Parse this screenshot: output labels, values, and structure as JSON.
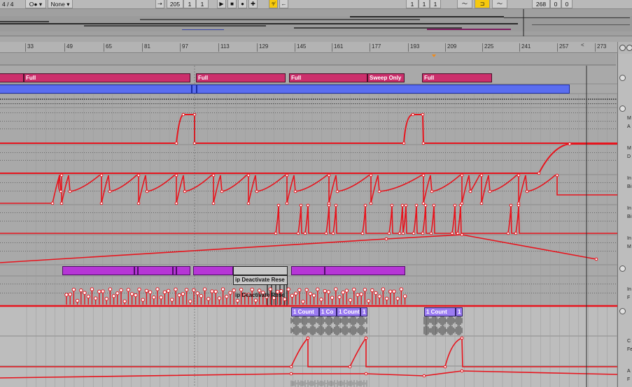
{
  "transport": {
    "time_signature": "4 / 4",
    "quantize_symbol": "O●",
    "quantize_arrow": "▾",
    "none_label": "None",
    "none_arrow": "▾",
    "follow_arrow": "⇢",
    "arrangement_position": [
      "205",
      "1",
      "1"
    ],
    "play_glyph": "▶",
    "stop_glyph": "■",
    "record_glyph": "●",
    "add_glyph": "✚",
    "automation_glyph": "ᵒ∕",
    "back_glyph": "←",
    "loop_start": [
      "1",
      "1",
      "1"
    ],
    "loop_glyph": "⊐",
    "punch_in_glyph": "〜",
    "punch_out_glyph": "〜",
    "loop_length": [
      "268",
      "0",
      "0"
    ]
  },
  "ruler": {
    "bars": [
      "33",
      "49",
      "65",
      "81",
      "97",
      "113",
      "129",
      "145",
      "161",
      "177",
      "193",
      "209",
      "225",
      "241",
      "257",
      "273"
    ],
    "end_marker": "<"
  },
  "clips": {
    "row1": [
      {
        "label": "Full"
      },
      {
        "label": "Full"
      },
      {
        "label": "Full"
      },
      {
        "label": "Sweep Only"
      },
      {
        "label": "Full"
      }
    ],
    "deactivate_1": "ip Deactivate",
    "deactivate_1b": "Rese",
    "deactivate_2": "ip Deactivate",
    "deactivate_2b": "Rese",
    "counts": [
      {
        "label": "1 Count"
      },
      {
        "label": "1 Co"
      },
      {
        "label": "1 Count"
      },
      {
        "label": "1"
      },
      {
        "label": "1 Count"
      },
      {
        "label": "1"
      }
    ]
  },
  "right_panel": {
    "labels": [
      "M",
      "A",
      "M",
      "D",
      "In",
      "Bi",
      "In",
      "Bi",
      "In",
      "M",
      "In",
      "F",
      "C",
      "Fe",
      "A",
      "F"
    ]
  },
  "colors": {
    "automation": "#e8141d",
    "clip_pink": "#cc2f6c",
    "clip_blue": "#5a6df0",
    "clip_purple": "#b636d6",
    "clip_violet": "#9b7cf2",
    "highlight_yellow": "#f6c90e"
  }
}
